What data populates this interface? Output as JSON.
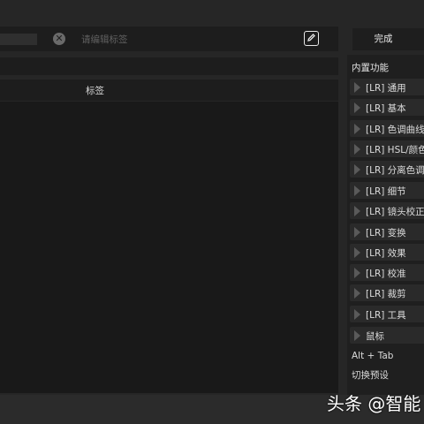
{
  "search": {
    "placeholder": "请编辑标签"
  },
  "toolbar": {
    "done_label": "完成"
  },
  "table": {
    "tag_header": "标签"
  },
  "sidebar": {
    "title": "内置功能",
    "items": [
      {
        "label": "[LR] 通用"
      },
      {
        "label": "[LR] 基本"
      },
      {
        "label": "[LR] 色调曲线"
      },
      {
        "label": "[LR] HSL/颜色"
      },
      {
        "label": "[LR] 分离色调"
      },
      {
        "label": "[LR] 细节"
      },
      {
        "label": "[LR] 镜头校正"
      },
      {
        "label": "[LR] 变换"
      },
      {
        "label": "[LR] 效果"
      },
      {
        "label": "[LR] 校准"
      },
      {
        "label": "[LR] 裁剪"
      },
      {
        "label": "[LR] 工具"
      },
      {
        "label": "鼠标"
      }
    ],
    "shortcut": "Alt + Tab",
    "switch_preset": "切换预设"
  },
  "watermark": "头条 @智能"
}
